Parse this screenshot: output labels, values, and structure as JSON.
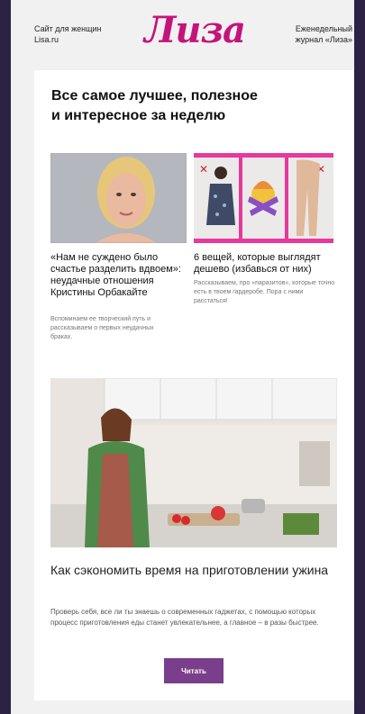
{
  "header": {
    "left_line1": "Сайт для женщин",
    "left_line2": "Lisa.ru",
    "logo": "Лиза",
    "right_line1": "Еженедельный",
    "right_line2": "журнал «Лиза»"
  },
  "digest": {
    "headline_line1": "Все самое лучшее, полезное",
    "headline_line2": "и интересное за неделю"
  },
  "articles": [
    {
      "title": "«Нам не суждено было счастье разделить вдвоем»: неудачные отношения Кристины Орбакайте",
      "description": "Вспоминаем ее творческий путь и рассказываем о первых неудачных браках."
    },
    {
      "title": "6 вещей, которые выглядят дешево (избавься от них)",
      "description": "Рассказываем, про «паразитов», которые точно есть в твоем гардеробе. Пора с ними расстаться!"
    }
  ],
  "feature": {
    "title": "Как сэкономить время на приготовлении ужина",
    "description": "Проверь себя, все ли ты знаешь о современных гаджетах, с помощью которых процесс приготовления еды станет увлекательнее, а главное – в разы быстрее.",
    "button_label": "Читать"
  },
  "colors": {
    "page_background": "#2b2244",
    "logo": "#c4147a",
    "button": "#7a3f8c"
  }
}
